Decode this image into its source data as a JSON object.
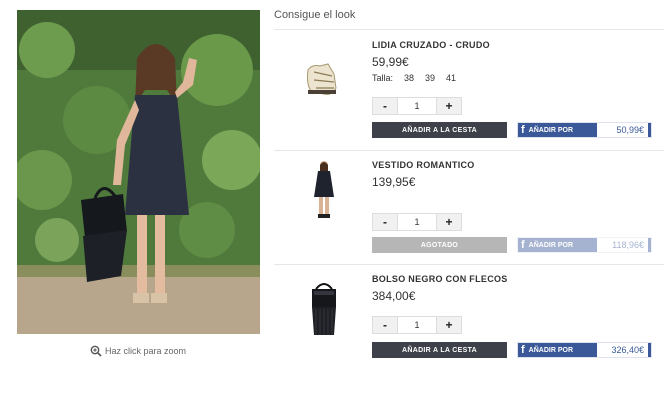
{
  "look": {
    "title": "Consigue el look",
    "zoom_label": "Haz click para zoom"
  },
  "products": [
    {
      "name": "LIDIA CRUZADO - CRUDO",
      "price": "59,99€",
      "size_label": "Talla:",
      "sizes": [
        "38",
        "39",
        "41"
      ],
      "quantity": "1",
      "minus": "-",
      "plus": "+",
      "cart_label": "AÑADIR A LA CESTA",
      "fb_label": "AÑADIR POR",
      "fb_price": "50,99€",
      "available": true
    },
    {
      "name": "VESTIDO ROMANTICO",
      "price": "139,95€",
      "quantity": "1",
      "minus": "-",
      "plus": "+",
      "cart_label": "AGOTADO",
      "fb_label": "AÑADIR POR",
      "fb_price": "118,96€",
      "available": false
    },
    {
      "name": "BOLSO NEGRO CON FLECOS",
      "price": "384,00€",
      "quantity": "1",
      "minus": "-",
      "plus": "+",
      "cart_label": "AÑADIR A LA CESTA",
      "fb_label": "AÑADIR POR",
      "fb_price": "326,40€",
      "available": true
    }
  ],
  "colors": {
    "cart_button": "#3e4149",
    "cart_disabled": "#b6b6b6",
    "facebook_blue": "#3b5998"
  },
  "icons": {
    "zoom": "magnifier-plus-icon",
    "facebook": "facebook-f-icon"
  }
}
